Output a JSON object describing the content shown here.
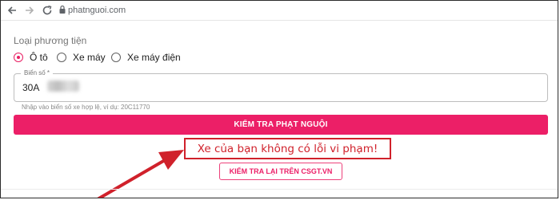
{
  "browser": {
    "url": "phatnguoi.com"
  },
  "form": {
    "vehicle_type_label": "Loại phương tiện",
    "vehicle_options": [
      {
        "label": "Ô tô",
        "checked": true
      },
      {
        "label": "Xe máy",
        "checked": false
      },
      {
        "label": "Xe máy điện",
        "checked": false
      }
    ],
    "plate_label": "Biển số *",
    "plate_value": "30A",
    "helper_text": "Nhập vào biển số xe hợp lệ, ví dụ: 20C11770",
    "check_button_label": "KIỂM TRA PHẠT NGUỘI"
  },
  "result": {
    "message": "Xe của bạn không có lỗi vi phạm!",
    "recheck_button_label": "KIỂM TRA LẠI TRÊN CSGT.VN"
  },
  "colors": {
    "accent": "#ec1f67",
    "annotation_red": "#d0212b"
  }
}
